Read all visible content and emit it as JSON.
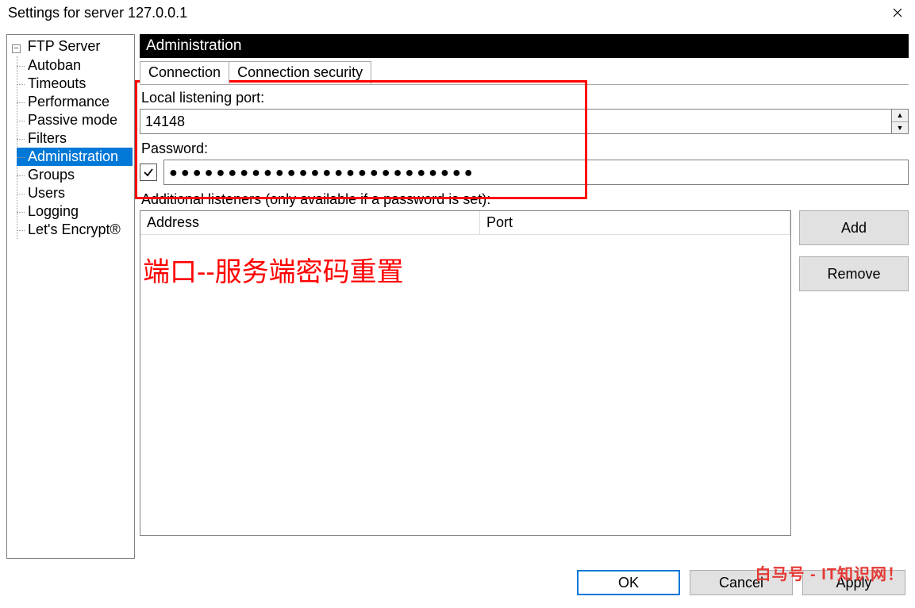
{
  "titlebar": {
    "title": "Settings for server 127.0.0.1"
  },
  "tree": {
    "root": "FTP Server",
    "items": [
      {
        "label": "Autoban"
      },
      {
        "label": "Timeouts"
      },
      {
        "label": "Performance"
      },
      {
        "label": "Passive mode"
      },
      {
        "label": "Filters"
      },
      {
        "label": "Administration",
        "selected": true
      },
      {
        "label": "Groups"
      },
      {
        "label": "Users"
      },
      {
        "label": "Logging"
      },
      {
        "label": "Let's Encrypt®"
      }
    ]
  },
  "section": {
    "title": "Administration"
  },
  "tabs": [
    {
      "label": "Connection",
      "active": true
    },
    {
      "label": "Connection security",
      "active": false
    }
  ],
  "fields": {
    "port_label": "Local listening port:",
    "port_value": "14148",
    "password_label": "Password:",
    "password_checked": true,
    "password_value": "●●●●●●●●●●●●●●●●●●●●●●●●●●",
    "listeners_label": "Additional listeners (only available if a password is set):"
  },
  "listeners": {
    "columns": {
      "address": "Address",
      "port": "Port"
    },
    "rows": []
  },
  "side_buttons": {
    "add": "Add",
    "remove": "Remove"
  },
  "footer": {
    "ok": "OK",
    "cancel": "Cancel",
    "apply": "Apply"
  },
  "annotation": {
    "text": "端口--服务端密码重置"
  },
  "watermark": "白马号 - IT知识网！"
}
